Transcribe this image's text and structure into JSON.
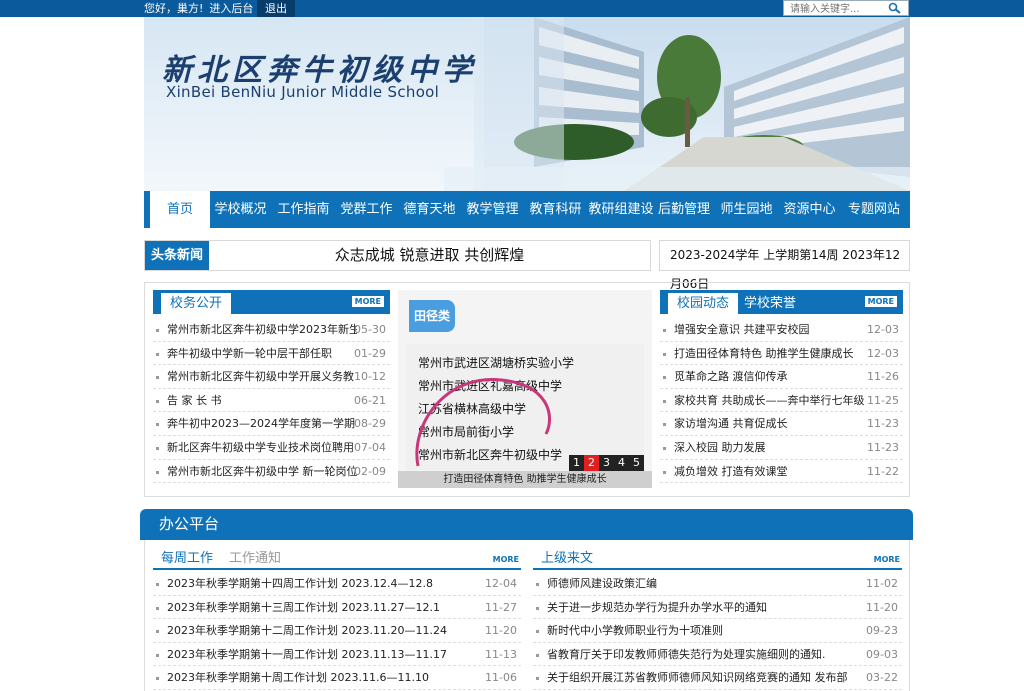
{
  "topbar": {
    "greeting": "您好，巢方!",
    "admin_link": "进入后台",
    "logout": "退出",
    "search_placeholder": "请输入关键字..."
  },
  "banner": {
    "title": "新北区奔牛初级中学",
    "subtitle": "XinBei BenNiu Junior Middle School"
  },
  "nav": [
    "首页",
    "学校概况",
    "工作指南",
    "党群工作",
    "德育天地",
    "教学管理",
    "教育科研",
    "教研组建设",
    "后勤管理",
    "师生园地",
    "资源中心",
    "专题网站"
  ],
  "headline": {
    "tag": "头条新闻",
    "text": "众志成城 锐意进取 共创辉煌",
    "date": "2023-2024学年 上学期第14周 2023年12月06日"
  },
  "school_affairs": {
    "tab": "校务公开",
    "more": "MORE",
    "items": [
      {
        "title": "常州市新北区奔牛初级中学2023年新生",
        "date": "05-30"
      },
      {
        "title": "奔牛初级中学新一轮中层干部任职",
        "date": "01-29"
      },
      {
        "title": "常州市新北区奔牛初级中学开展义务教",
        "date": "10-12"
      },
      {
        "title": "告 家 长 书",
        "date": "06-21"
      },
      {
        "title": "奔牛初中2023—2024学年度第一学期",
        "date": "08-29"
      },
      {
        "title": "新北区奔牛初级中学专业技术岗位聘用",
        "date": "07-04"
      },
      {
        "title": "常州市新北区奔牛初级中学 新一轮岗位",
        "date": "02-09"
      }
    ]
  },
  "slideshow": {
    "category": "田径类",
    "lines": [
      "常州市武进区湖塘桥实验小学",
      "常州市武进区礼嘉高级中学",
      "江苏省横林高级中学",
      "常州市局前街小学",
      "常州市新北区奔牛初级中学"
    ],
    "pages": [
      "1",
      "2",
      "3",
      "4",
      "5"
    ],
    "current_page": 2,
    "caption": "打造田径体育特色 助推学生健康成长"
  },
  "campus_news": {
    "tabs": [
      "校园动态",
      "学校荣誉"
    ],
    "more": "MORE",
    "items": [
      {
        "title": "增强安全意识 共建平安校园",
        "date": "12-03"
      },
      {
        "title": "打造田径体育特色 助推学生健康成长",
        "date": "12-03"
      },
      {
        "title": "觅革命之路 渡信仰传承",
        "date": "11-26"
      },
      {
        "title": "家校共育 共助成长——奔中举行七年级",
        "date": "11-25"
      },
      {
        "title": "家访增沟通 共育促成长",
        "date": "11-23"
      },
      {
        "title": "深入校园 助力发展",
        "date": "11-23"
      },
      {
        "title": "减负增效 打造有效课堂",
        "date": "11-22"
      }
    ]
  },
  "office": {
    "title": "办公平台",
    "left_tabs": [
      "每周工作",
      "工作通知"
    ],
    "right_tab": "上级来文",
    "more": "MORE",
    "weekly": [
      {
        "title": "2023年秋季学期第十四周工作计划 2023.12.4—12.8",
        "date": "12-04"
      },
      {
        "title": "2023年秋季学期第十三周工作计划 2023.11.27—12.1",
        "date": "11-27"
      },
      {
        "title": "2023年秋季学期第十二周工作计划 2023.11.20—11.24",
        "date": "11-20"
      },
      {
        "title": "2023年秋季学期第十一周工作计划 2023.11.13—11.17",
        "date": "11-13"
      },
      {
        "title": "2023年秋季学期第十周工作计划 2023.11.6—11.10",
        "date": "11-06"
      }
    ],
    "documents": [
      {
        "title": "师德师风建设政策汇编",
        "date": "11-02"
      },
      {
        "title": "关于进一步规范办学行为提升办学水平的通知",
        "date": "11-20"
      },
      {
        "title": "新时代中小学教师职业行为十项准则",
        "date": "09-23"
      },
      {
        "title": "省教育厅关于印发教师师德失范行为处理实施细则的通知.",
        "date": "09-03"
      },
      {
        "title": "关于组织开展江苏省教师师德师风知识网络竞赛的通知 发布部",
        "date": "03-22"
      }
    ]
  },
  "colors": {
    "primary": "#0f72b8",
    "topbar": "#0b5a9c",
    "current_page": "#e02020"
  }
}
